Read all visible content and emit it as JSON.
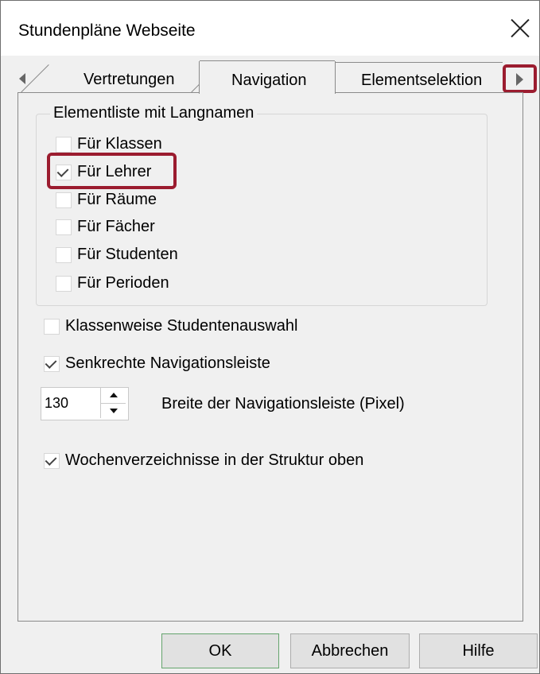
{
  "window": {
    "title": "Stundenpläne Webseite"
  },
  "tabs": [
    {
      "label": "Vertretungen"
    },
    {
      "label": "Navigation"
    },
    {
      "label": "Elementselektion"
    }
  ],
  "group": {
    "label": "Elementliste mit Langnamen",
    "items": [
      {
        "label": "Für Klassen",
        "checked": false
      },
      {
        "label": "Für Lehrer",
        "checked": true
      },
      {
        "label": "Für Räume",
        "checked": false
      },
      {
        "label": "Für Fächer",
        "checked": false
      },
      {
        "label": "Für Studenten",
        "checked": false
      },
      {
        "label": "Für Perioden",
        "checked": false
      }
    ]
  },
  "options": {
    "student_select": {
      "label": "Klassenweise Studentenauswahl",
      "checked": false
    },
    "vertical_nav": {
      "label": "Senkrechte Navigationsleiste",
      "checked": true
    },
    "nav_width": {
      "value": "130",
      "label": "Breite der Navigationsleiste (Pixel)"
    },
    "weekly_dirs": {
      "label": "Wochenverzeichnisse in der Struktur oben",
      "checked": true
    }
  },
  "buttons": {
    "ok": "OK",
    "cancel": "Abbrechen",
    "help": "Hilfe"
  },
  "colors": {
    "highlight": "#9b1c2f",
    "window_bg": "#f0f0f0",
    "ok_border": "#64a46d"
  },
  "icons": [
    "close-icon",
    "tab-scroll-left-icon",
    "tab-scroll-right-icon",
    "check-icon",
    "spin-up-icon",
    "spin-down-icon"
  ]
}
